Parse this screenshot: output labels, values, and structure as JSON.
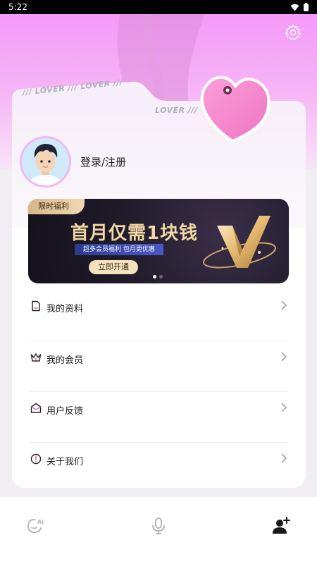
{
  "status_bar": {
    "time": "5:22"
  },
  "profile": {
    "login_label": "登录/注册"
  },
  "decorations": {
    "lover_1": "/// LOVER /// LOVER ///",
    "lover_2": "LOVER ///"
  },
  "banner": {
    "tag": "限时福利",
    "title": "首月仅需1块钱",
    "subtitle": "超多会员福利 包月更优惠",
    "cta": "立即开通",
    "active_slide": 1,
    "slide_count": 2
  },
  "menu": {
    "items": [
      {
        "label": "我的资料",
        "icon": "profile-doc-icon"
      },
      {
        "label": "我的会员",
        "icon": "crown-icon"
      },
      {
        "label": "用户反馈",
        "icon": "feedback-mail-icon"
      },
      {
        "label": "关于我们",
        "icon": "info-icon"
      }
    ]
  },
  "bottom_nav": {
    "items": [
      {
        "icon": "ai-chat-icon",
        "active": false
      },
      {
        "icon": "microphone-icon",
        "active": false
      },
      {
        "icon": "user-add-icon",
        "active": true
      }
    ]
  },
  "colors": {
    "hero_pink": "#f49af8",
    "heart_pink": "#f27ec6",
    "gold": "#f3d7a4",
    "banner_dark": "#1e1a28"
  }
}
